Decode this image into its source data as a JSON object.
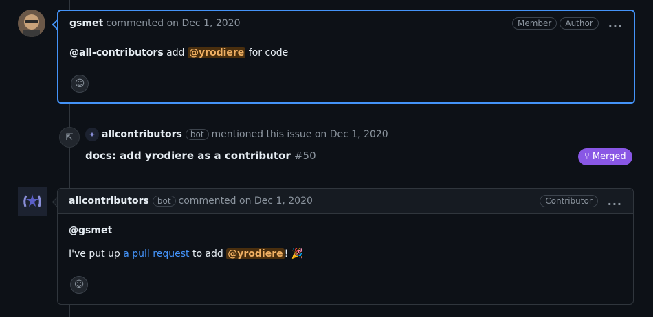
{
  "comment1": {
    "author": "gsmet",
    "meta": "commented on Dec 1, 2020",
    "labels": [
      "Member",
      "Author"
    ],
    "body": {
      "mention": "@all-contributors",
      "word_add": "add",
      "highlight": "@yrodiere",
      "tail": "for code"
    }
  },
  "event": {
    "author": "allcontributors",
    "bot_label": "bot",
    "meta": "mentioned this issue on Dec 1, 2020",
    "pr_title": "docs: add yrodiere as a contributor",
    "pr_number": "#50",
    "status": "Merged"
  },
  "comment2": {
    "author": "allcontributors",
    "bot_label": "bot",
    "meta": "commented on Dec 1, 2020",
    "label": "Contributor",
    "greeting": "@gsmet",
    "line_prefix": "I've put up",
    "link_text": "a pull request",
    "line_mid": "to add",
    "highlight": "@yrodiere",
    "line_end": "!",
    "emoji": "🎉"
  },
  "icons": {
    "kebab": "...",
    "smiley": "☺",
    "crossref": "⇱",
    "merge": "⑂"
  },
  "colors": {
    "accent": "#4493f8",
    "merged": "#8957e5",
    "mention_bg": "#4a2f0e"
  }
}
